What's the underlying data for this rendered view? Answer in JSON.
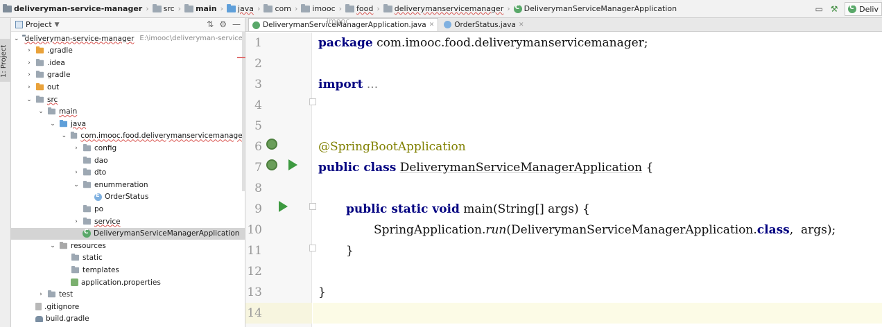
{
  "breadcrumb": [
    {
      "label": "deliveryman-service-manager",
      "icon": "module-folder",
      "bold": true
    },
    {
      "label": "src",
      "icon": "folder"
    },
    {
      "label": "main",
      "icon": "folder",
      "bold": true
    },
    {
      "label": "java",
      "icon": "source-folder-blue",
      "underline": true
    },
    {
      "label": "com",
      "icon": "package-folder"
    },
    {
      "label": "imooc",
      "icon": "package-folder"
    },
    {
      "label": "food",
      "icon": "package-folder",
      "underline": true
    },
    {
      "label": "deliverymanservicemanager",
      "icon": "package-folder",
      "underline": true
    },
    {
      "label": "DeliverymanServiceManagerApplication",
      "icon": "spring-app-class"
    }
  ],
  "nav_right": {
    "run_config_label": "Deliv"
  },
  "tool_stripe": {
    "label": "1: Project"
  },
  "project_panel": {
    "title": "Project",
    "tree": [
      {
        "label": "deliveryman-service-manager",
        "depth": 0,
        "arrow": "open",
        "icon": "module",
        "underline": true,
        "path": "E:\\imooc\\deliveryman-service-m"
      },
      {
        "label": ".gradle",
        "depth": 1,
        "arrow": "closed",
        "icon": "orange"
      },
      {
        "label": ".idea",
        "depth": 1,
        "arrow": "closed",
        "icon": "gray"
      },
      {
        "label": "gradle",
        "depth": 1,
        "arrow": "closed",
        "icon": "gray"
      },
      {
        "label": "out",
        "depth": 1,
        "arrow": "closed",
        "icon": "orange"
      },
      {
        "label": "src",
        "depth": 1,
        "arrow": "open",
        "icon": "gray",
        "underline": true
      },
      {
        "label": "main",
        "depth": 2,
        "arrow": "open",
        "icon": "gray",
        "underline": true
      },
      {
        "label": "java",
        "depth": 3,
        "arrow": "open",
        "icon": "blue",
        "underline": true
      },
      {
        "label": "com.imooc.food.deliverymanservicemanager",
        "depth": 4,
        "arrow": "open",
        "icon": "gray",
        "underline": true
      },
      {
        "label": "config",
        "depth": 5,
        "arrow": "closed",
        "icon": "gray"
      },
      {
        "label": "dao",
        "depth": 5,
        "arrow": "none",
        "icon": "gray"
      },
      {
        "label": "dto",
        "depth": 5,
        "arrow": "closed",
        "icon": "gray"
      },
      {
        "label": "enummeration",
        "depth": 5,
        "arrow": "open",
        "icon": "gray"
      },
      {
        "label": "OrderStatus",
        "depth": 6,
        "arrow": "none",
        "icon": "enum"
      },
      {
        "label": "po",
        "depth": 5,
        "arrow": "none",
        "icon": "gray"
      },
      {
        "label": "service",
        "depth": 5,
        "arrow": "closed",
        "icon": "gray",
        "underline": true
      },
      {
        "label": "DeliverymanServiceManagerApplication",
        "depth": 5,
        "arrow": "none",
        "icon": "spring",
        "selected": true
      },
      {
        "label": "resources",
        "depth": 3,
        "arrow": "open",
        "icon": "res"
      },
      {
        "label": "static",
        "depth": 4,
        "arrow": "none",
        "icon": "gray"
      },
      {
        "label": "templates",
        "depth": 4,
        "arrow": "none",
        "icon": "gray"
      },
      {
        "label": "application.properties",
        "depth": 4,
        "arrow": "none",
        "icon": "props"
      },
      {
        "label": "test",
        "depth": 2,
        "arrow": "closed",
        "icon": "gray"
      },
      {
        "label": ".gitignore",
        "depth": 1,
        "arrow": "none",
        "icon": "file"
      },
      {
        "label": "build.gradle",
        "depth": 1,
        "arrow": "none",
        "icon": "gradle"
      }
    ]
  },
  "editor": {
    "tabs": [
      {
        "label": "DeliverymanServiceManagerApplication.java",
        "active": true,
        "icon": "spring"
      },
      {
        "label": "OrderStatus.java",
        "active": false,
        "icon": "enum"
      }
    ],
    "tab_tooltip": "imooc",
    "line_numbers": [
      "1",
      "2",
      "3",
      "4",
      "5",
      "6",
      "7",
      "8",
      "9",
      "10",
      "11",
      "12",
      "13",
      "14"
    ],
    "code": {
      "l1_kw": "package",
      "l1_rest": " com.imooc.food.deliverymanservicemanager;",
      "l3_kw": "import",
      "l3_rest": " ...",
      "l6_ann": "@SpringBootApplication",
      "l7_kw": "public class",
      "l7_cls": "DeliverymanServiceManagerApplication",
      "l7_rest": " {",
      "l9_kw": "public static void",
      "l9_rest": " main(String[] args) {",
      "l10_a": "SpringApplication.",
      "l10_run": "run",
      "l10_b": "(DeliverymanServiceManagerApplication.",
      "l10_kw": "class",
      "l10_c": ",  args);",
      "l11": "}",
      "l13": "}"
    }
  }
}
